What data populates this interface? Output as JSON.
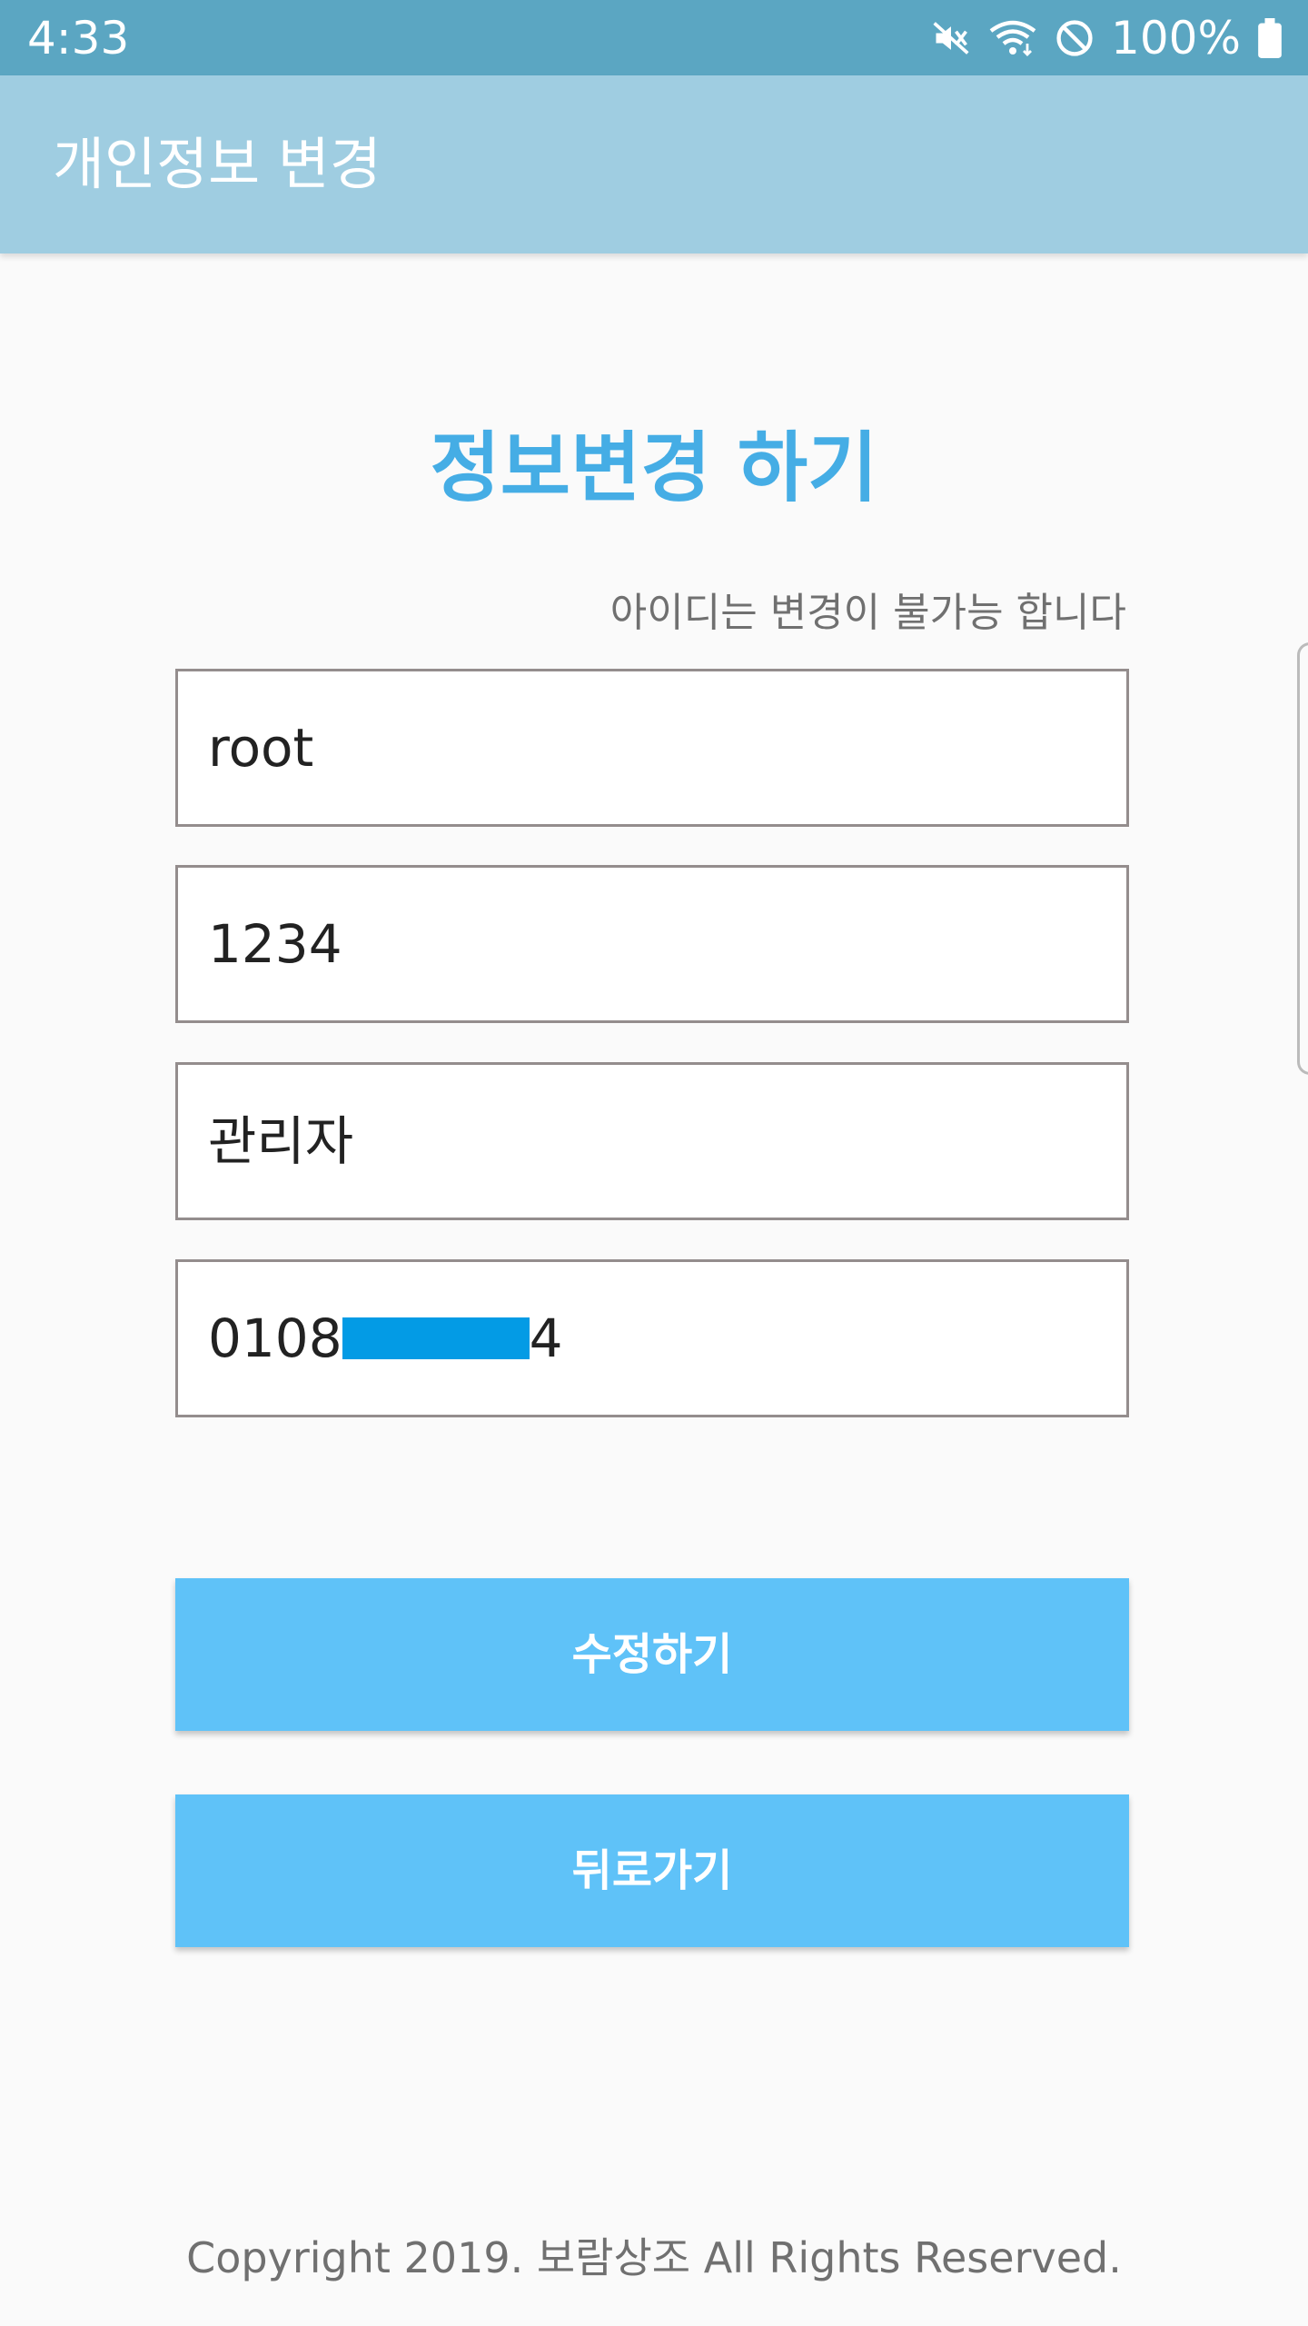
{
  "status_bar": {
    "time": "4:33",
    "battery": "100%",
    "icons": [
      "mute-icon",
      "wifi-icon",
      "do-not-disturb-icon",
      "battery-icon"
    ]
  },
  "app_bar": {
    "title": "개인정보 변경"
  },
  "form": {
    "heading": "정보변경 하기",
    "notice": "아이디는 변경이 불가능 합니다",
    "id_value": "root",
    "password_value": "1234",
    "name_value": "관리자",
    "phone_prefix": "0108",
    "phone_suffix": "4",
    "save_label": "수정하기",
    "back_label": "뒤로가기"
  },
  "footer": {
    "copyright": "Copyright 2019. 보람상조 All Rights Reserved."
  },
  "colors": {
    "status_bar": "#5ba6c2",
    "app_bar": "#9fcde1",
    "heading": "#45ade5",
    "button": "#5fc2f8",
    "redaction": "#039be5"
  }
}
